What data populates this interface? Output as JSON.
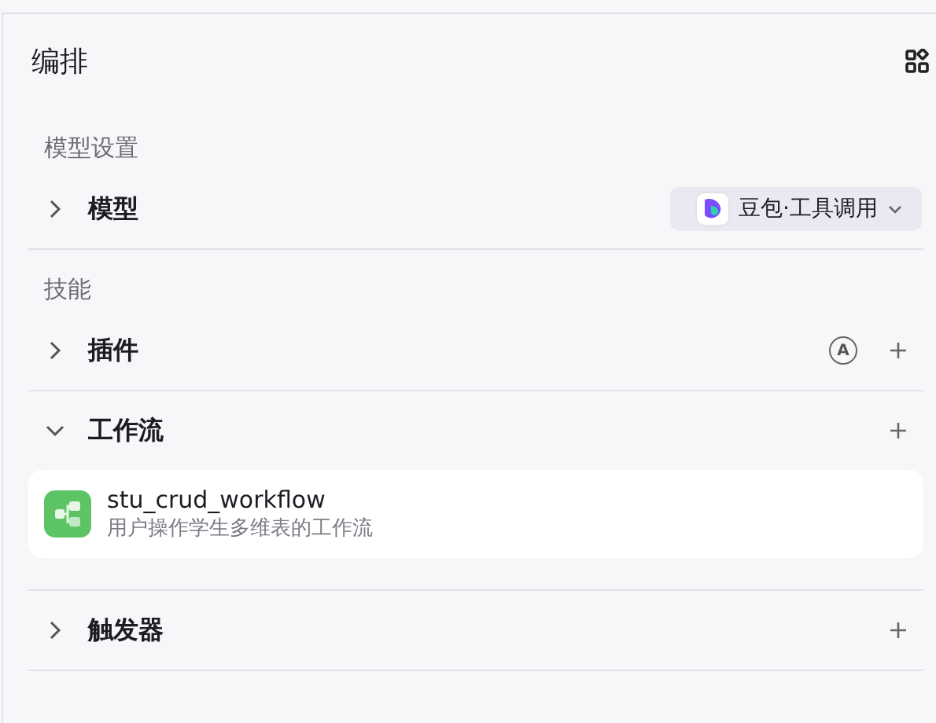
{
  "title": "编排",
  "sections": [
    {
      "heading": "模型设置",
      "rows": [
        {
          "label": "模型",
          "expanded": false,
          "model": {
            "name": "豆包·工具调用"
          }
        }
      ]
    },
    {
      "heading": "技能",
      "rows": [
        {
          "label": "插件",
          "expanded": false,
          "auto_badge": "A",
          "addable": true
        },
        {
          "label": "工作流",
          "expanded": true,
          "addable": true,
          "items": [
            {
              "name": "stu_crud_workflow",
              "description": "用户操作学生多维表的工作流"
            }
          ]
        },
        {
          "label": "触发器",
          "expanded": false,
          "addable": true
        }
      ]
    }
  ]
}
